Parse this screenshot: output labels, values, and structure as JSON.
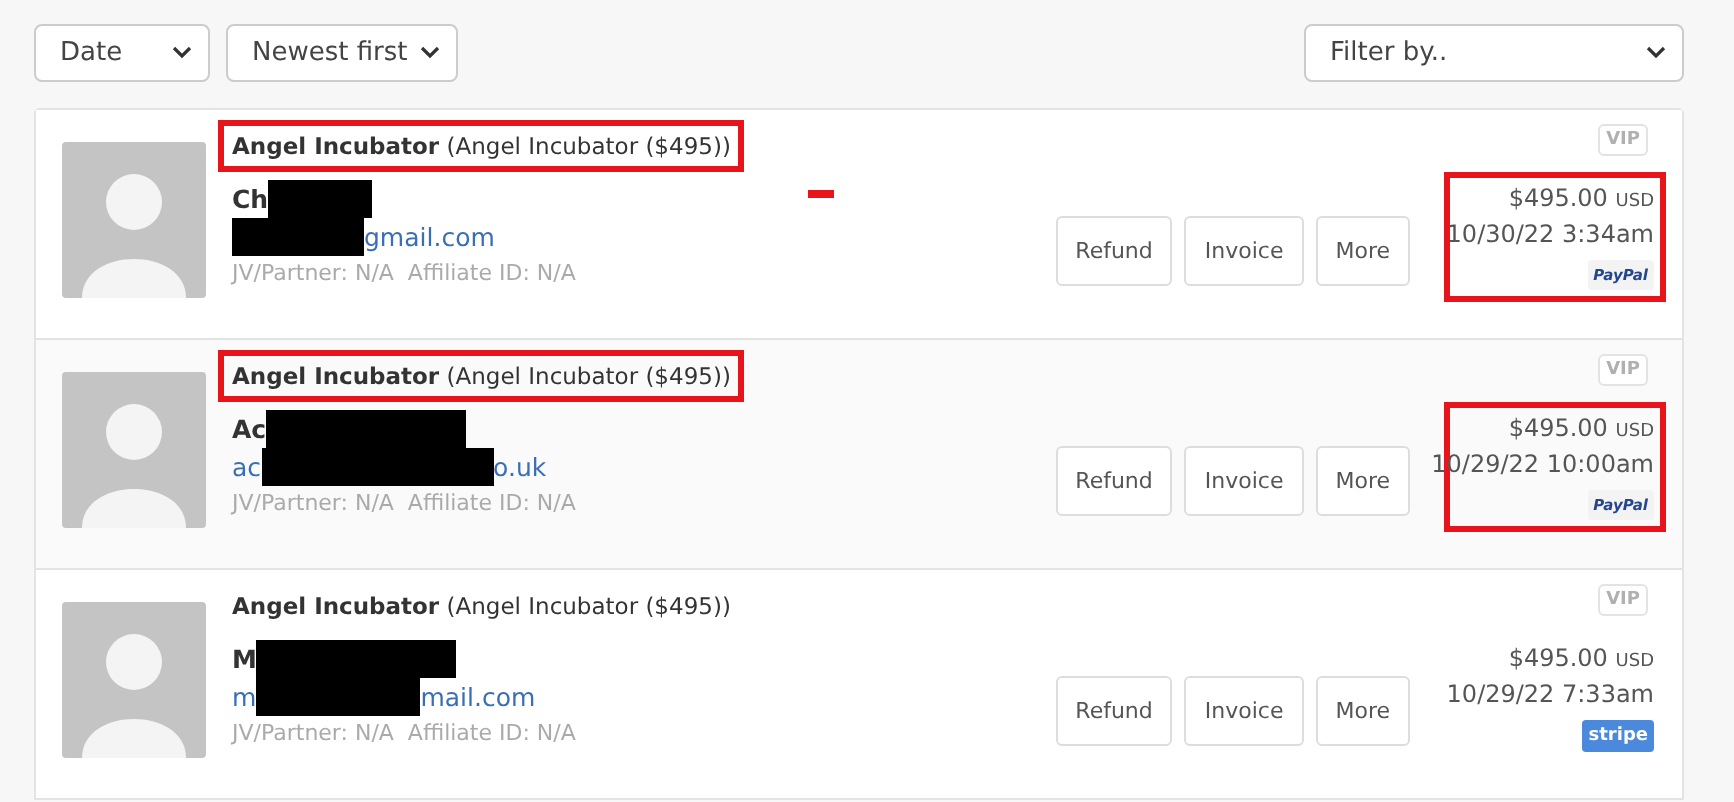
{
  "toolbar": {
    "sort_field": "Date",
    "sort_order": "Newest first",
    "filter": "Filter by.."
  },
  "orders": [
    {
      "product": "Angel Incubator",
      "variant": "(Angel Incubator ($495))",
      "name": "Ch",
      "email_end": "gmail.com",
      "meta": "JV/Partner: N/A  Affiliate ID: N/A",
      "buttons": [
        "Refund",
        "Invoice",
        "More"
      ],
      "vip": "VIP",
      "amount": "$495.00",
      "currency": "USD",
      "date": "10/30/22 3:34am",
      "payment": {
        "kind": "paypal",
        "label": "PayPal"
      },
      "highlighted": true,
      "annotation_mark": true
    },
    {
      "product": "Angel Incubator",
      "variant": "(Angel Incubator ($495))",
      "name": "Ac",
      "email_start": "ac",
      "email_end": "o.uk",
      "meta": "JV/Partner: N/A  Affiliate ID: N/A",
      "buttons": [
        "Refund",
        "Invoice",
        "More"
      ],
      "vip": "VIP",
      "amount": "$495.00",
      "currency": "USD",
      "date": "10/29/22 10:00am",
      "payment": {
        "kind": "paypal",
        "label": "PayPal"
      },
      "highlighted": true,
      "annotation_mark": false
    },
    {
      "product": "Angel Incubator",
      "variant": "(Angel Incubator ($495))",
      "name": "M",
      "email_start": "m",
      "email_end": "mail.com",
      "meta": "JV/Partner: N/A  Affiliate ID: N/A",
      "buttons": [
        "Refund",
        "Invoice",
        "More"
      ],
      "vip": "VIP",
      "amount": "$495.00",
      "currency": "USD",
      "date": "10/29/22 7:33am",
      "payment": {
        "kind": "stripe",
        "label": "stripe"
      },
      "highlighted": false,
      "annotation_mark": false
    }
  ]
}
